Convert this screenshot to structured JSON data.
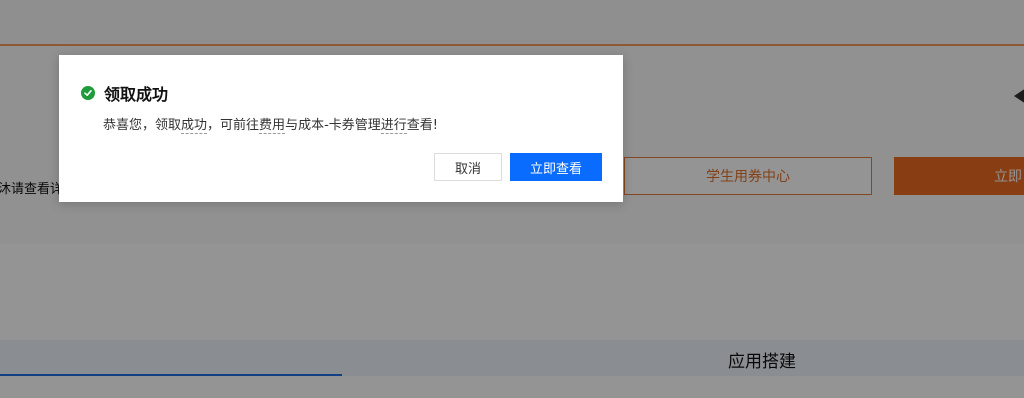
{
  "background": {
    "left_partial_text": "沐请查看详细",
    "student_coupon_button": "学生用券中心",
    "now_button_partial": "立即",
    "tab_label_app": "应用搭建"
  },
  "dialog": {
    "title": "领取成功",
    "message_parts": {
      "p1": "恭喜您，领取",
      "p2": "成功",
      "p3": "，可前往",
      "p4": "费用",
      "p5": "与成本-卡券管理",
      "p6": "进行",
      "p7": "查看!"
    },
    "cancel_label": "取消",
    "confirm_label": "立即查看"
  },
  "colors": {
    "accent_blue": "#0a6cff",
    "success_green": "#1e9b3b",
    "brand_orange": "#ed6a1f"
  }
}
